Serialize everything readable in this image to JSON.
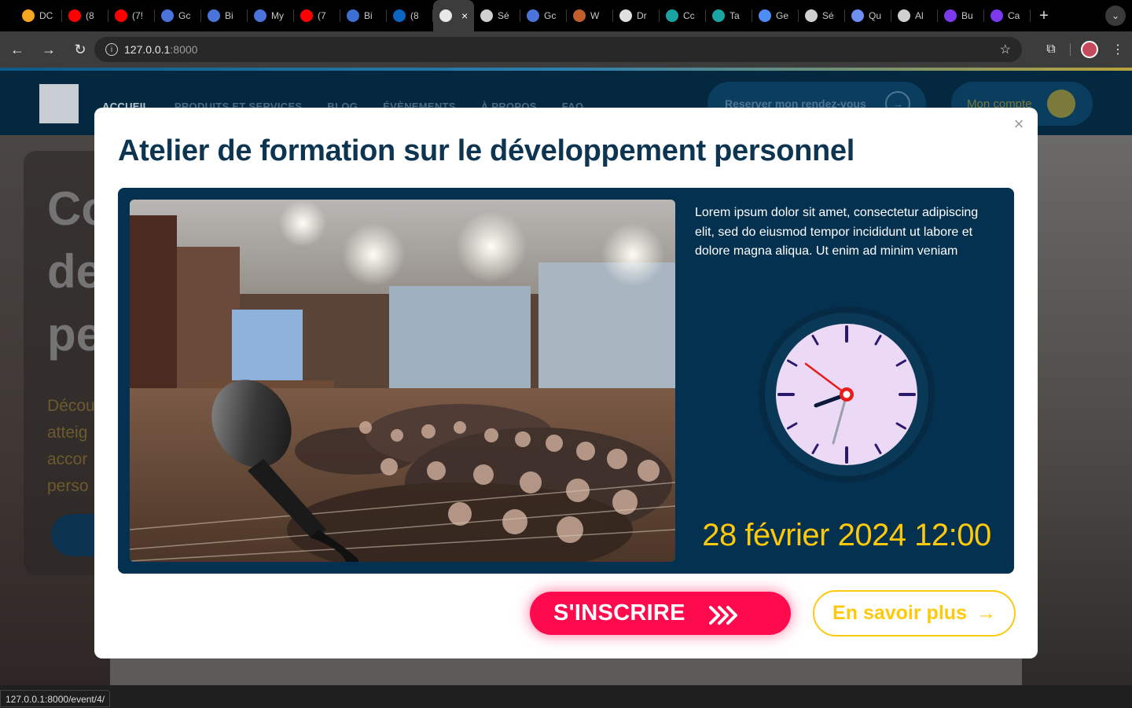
{
  "browser": {
    "tabs": [
      {
        "title": "DC",
        "icon": "drive-icon",
        "color": "#f4a61f"
      },
      {
        "title": "(8",
        "icon": "youtube-icon",
        "color": "#ff0000"
      },
      {
        "title": "(7!",
        "icon": "youtube-icon",
        "color": "#ff0000"
      },
      {
        "title": "Gc",
        "icon": "c-icon",
        "color": "#4a74d9"
      },
      {
        "title": "Bi",
        "icon": "c-icon",
        "color": "#4a74d9"
      },
      {
        "title": "My",
        "icon": "c-icon",
        "color": "#4a74d9"
      },
      {
        "title": "(7",
        "icon": "youtube-icon",
        "color": "#ff0000"
      },
      {
        "title": "Bi",
        "icon": "store-icon",
        "color": "#3b6fd1"
      },
      {
        "title": "(8",
        "icon": "linkedin-icon",
        "color": "#0a66c2"
      },
      {
        "title": "",
        "icon": "page-icon",
        "color": "#e8e8e8",
        "active": true
      },
      {
        "title": "Sé",
        "icon": "openai-icon",
        "color": "#d0d0d0"
      },
      {
        "title": "Gc",
        "icon": "c-icon",
        "color": "#4a74d9"
      },
      {
        "title": "W",
        "icon": "w-icon",
        "color": "#c25e2b"
      },
      {
        "title": "Dr",
        "icon": "dribbble-icon",
        "color": "#e0e0e0"
      },
      {
        "title": "Cc",
        "icon": "s-icon",
        "color": "#1ba3a3"
      },
      {
        "title": "Ta",
        "icon": "s-icon",
        "color": "#1ba3a3"
      },
      {
        "title": "Ge",
        "icon": "gemini-icon",
        "color": "#4e8cf7"
      },
      {
        "title": "Sé",
        "icon": "openai-icon",
        "color": "#d0d0d0"
      },
      {
        "title": "Qu",
        "icon": "q-icon",
        "color": "#6d8ff2"
      },
      {
        "title": "Al",
        "icon": "loader-icon",
        "color": "#d0d0d0"
      },
      {
        "title": "Bu",
        "icon": "ui-icon",
        "color": "#7c3aed"
      },
      {
        "title": "Ca",
        "icon": "ui-icon",
        "color": "#7c3aed"
      }
    ],
    "url_host": "127.0.0.1",
    "url_port": ":8000",
    "status_url": "127.0.0.1:8000/event/4/"
  },
  "site": {
    "nav": [
      "ACCUEIL",
      "PRODUITS ET SERVICES",
      "BLOG",
      "ÉVÈNEMENTS",
      "À PROPOS",
      "FAQ"
    ],
    "rdv_label": "Reserver mon rendez-vous",
    "account_label": "Mon compte",
    "hero_title_lines": [
      "Co",
      "de",
      "pe"
    ],
    "hero_text_lines": [
      "Décou",
      "atteig",
      "accor",
      "perso"
    ]
  },
  "modal": {
    "title": "Atelier de formation sur le développement personnel",
    "description": "Lorem ipsum dolor sit amet, consectetur adipiscing elit, sed do eiusmod tempor incididunt ut labore et dolore magna aliqua. Ut enim ad minim veniam",
    "date": "28 février 2024 12:00",
    "register_label": "S'INSCRIRE",
    "more_label": "En savoir plus",
    "colors": {
      "accent": "#ff0a4c",
      "gold": "#ffc90b",
      "navy": "#04314f"
    }
  }
}
